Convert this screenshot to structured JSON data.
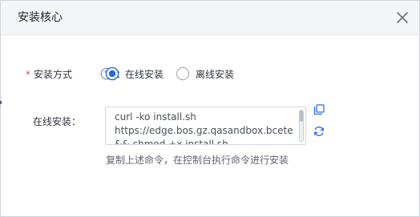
{
  "dialog": {
    "title": "安装核心",
    "close_icon": "close-icon"
  },
  "method": {
    "required_mark": "*",
    "label": "安装方式",
    "help_icon": "question-circle-icon",
    "colon": "：",
    "options": [
      {
        "label": "在线安装",
        "selected": true
      },
      {
        "label": "离线安装",
        "selected": false
      }
    ]
  },
  "online": {
    "label": "在线安装：",
    "command": "curl -ko install.sh\nhttps://edge.bos.gz.qasandbox.bcete\n&& chmod +x install.sh",
    "copy_icon": "copy-icon",
    "refresh_icon": "refresh-icon",
    "hint": "复制上述命令，在控制台执行命令进行安装"
  },
  "colors": {
    "accent": "#2468f2",
    "required": "#e64552",
    "header_bg": "#f4f5f7"
  }
}
